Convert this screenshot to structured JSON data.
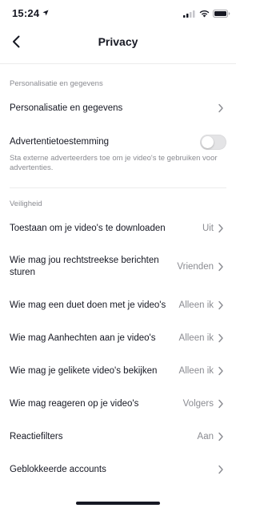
{
  "status_bar": {
    "time": "15:24"
  },
  "nav": {
    "title": "Privacy"
  },
  "sections": {
    "personalisation": {
      "header": "Personalisatie en gegevens",
      "items": [
        {
          "label": "Personalisatie en gegevens",
          "value": ""
        },
        {
          "label": "Advertentietoestemming",
          "toggle_on": false,
          "description": "Sta externe adverteerders toe om je video's te gebruiken voor advertenties."
        }
      ]
    },
    "safety": {
      "header": "Veiligheid",
      "items": [
        {
          "label": "Toestaan om je video's te downloaden",
          "value": "Uit"
        },
        {
          "label": "Wie mag jou rechtstreekse berichten sturen",
          "value": "Vrienden"
        },
        {
          "label": "Wie mag een duet doen met je video's",
          "value": "Alleen ik"
        },
        {
          "label": "Wie mag Aanhechten aan je video's",
          "value": "Alleen ik"
        },
        {
          "label": "Wie mag je gelikete video's bekijken",
          "value": "Alleen ik"
        },
        {
          "label": "Wie mag reageren op je video's",
          "value": "Volgers"
        },
        {
          "label": "Reactiefilters",
          "value": "Aan"
        },
        {
          "label": "Geblokkeerde accounts",
          "value": ""
        }
      ]
    }
  },
  "colors": {
    "text_primary": "#161823",
    "text_secondary": "#8a8b91",
    "divider": "#ececec",
    "toggle_off": "#e4e4e6"
  }
}
